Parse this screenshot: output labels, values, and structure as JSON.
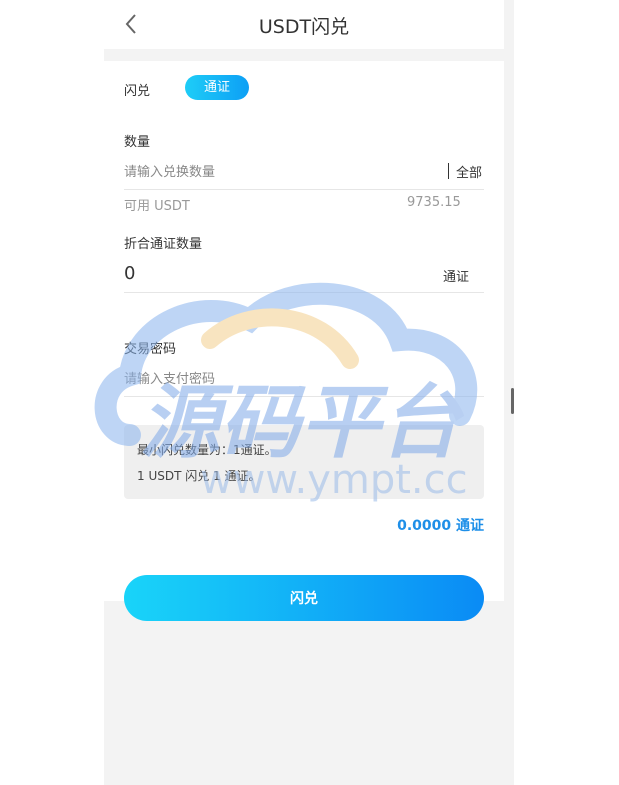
{
  "header": {
    "title": "USDT闪兑",
    "back_icon": "chevron-left-icon"
  },
  "form": {
    "coin_label": "闪兑",
    "coin_selected": "通证",
    "quantity_label": "数量",
    "quantity_placeholder": "请输入兑换数量",
    "all_label": "全部",
    "available_label": "可用 USDT",
    "available_value": "9735.15",
    "converted_label": "折合通证数量",
    "converted_value": "0",
    "converted_unit": "通证",
    "password_label": "交易密码",
    "password_placeholder": "请输入支付密码"
  },
  "notice": {
    "line1": "最小闪兑数量为：1通证。",
    "line2": "1 USDT 闪兑 1 通证。"
  },
  "total": "0.0000 通证",
  "submit_label": "闪兑",
  "watermark": {
    "title": "源码平台",
    "url": "www.ympt.cc"
  },
  "colors": {
    "accent": "#1e8fe8",
    "gradient_start": "#19d4f9",
    "gradient_end": "#0a8bf5"
  }
}
